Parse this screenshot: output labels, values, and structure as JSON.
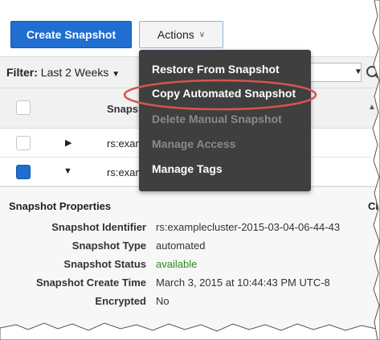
{
  "toolbar": {
    "create_snapshot": "Create Snapshot",
    "actions": "Actions"
  },
  "filter": {
    "label": "Filter:",
    "value": "Last 2 Weeks"
  },
  "table": {
    "column_partial": "Snaps",
    "rows": [
      {
        "text": "rs:exam",
        "checked": false
      },
      {
        "text": "rs:exam",
        "checked": true
      }
    ]
  },
  "menu": {
    "items": [
      {
        "label": "Restore From Snapshot",
        "enabled": true
      },
      {
        "label": "Copy Automated Snapshot",
        "enabled": true
      },
      {
        "label": "Delete Manual Snapshot",
        "enabled": false
      },
      {
        "label": "Manage Access",
        "enabled": false
      },
      {
        "label": "Manage Tags",
        "enabled": true
      }
    ]
  },
  "details": {
    "title": "Snapshot Properties",
    "title_right_partial": "Cl",
    "rows": [
      {
        "key": "Snapshot Identifier",
        "value": "rs:examplecluster-2015-03-04-06-44-43"
      },
      {
        "key": "Snapshot Type",
        "value": "automated"
      },
      {
        "key": "Snapshot Status",
        "value": "available"
      },
      {
        "key": "Snapshot Create Time",
        "value": "March 3, 2015 at 10:44:43 PM UTC-8"
      },
      {
        "key": "Encrypted",
        "value": "No"
      }
    ]
  },
  "colors": {
    "primary": "#1f6ed0",
    "menu_bg": "#3f3f3f",
    "status_green": "#2a8a1f",
    "highlight_oval": "#d9534f"
  },
  "icons": {
    "actions_chevron": "chevron-down-icon",
    "filter_dropdown": "caret-down-icon",
    "search": "search-icon",
    "expand_row": "triangle-right-icon",
    "collapse_row": "triangle-down-icon"
  }
}
